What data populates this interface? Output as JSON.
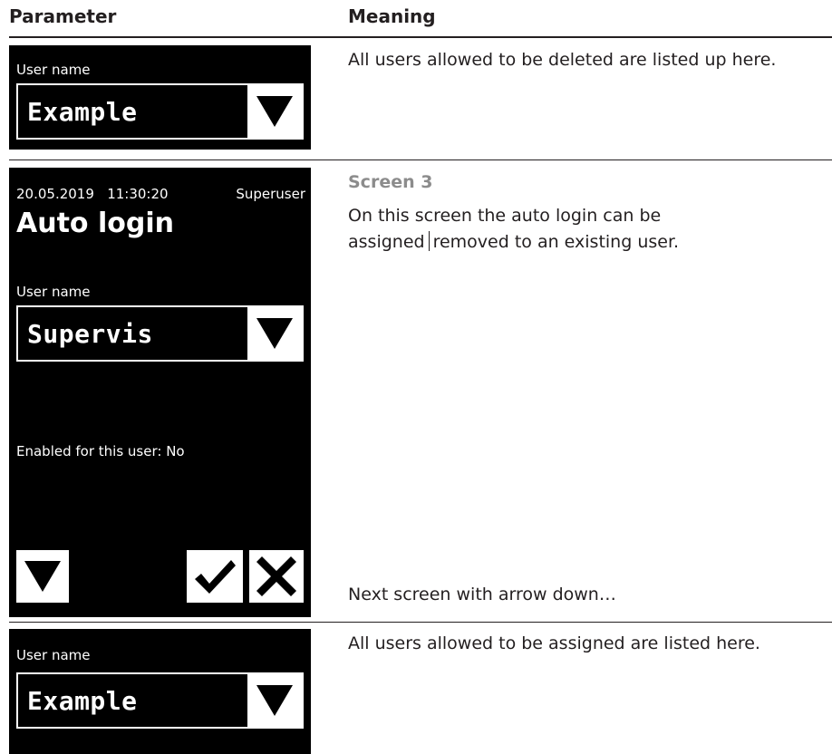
{
  "table": {
    "header_parameter": "Parameter",
    "header_meaning": "Meaning"
  },
  "row1": {
    "field_label": "User name",
    "field_value": "Example",
    "meaning": "All users allowed to be deleted are listed up here."
  },
  "row2": {
    "datetime": "20.05.2019   11:30:20",
    "user": "Superuser",
    "screen_title": "Auto login",
    "field_label": "User name",
    "field_value": "Supervis",
    "status_text": "Enabled for this user: No",
    "section_title": "Screen 3",
    "desc_part1": "On this screen the auto login can be",
    "desc_part2a": "assigned",
    "desc_part2b": "removed to an existing user.",
    "next_note": "Next screen with arrow down…"
  },
  "row3": {
    "field_label": "User name",
    "field_value": "Example",
    "meaning": "All users allowed to be assigned are listed here."
  },
  "icons": [
    "arrow-down-icon",
    "check-icon",
    "close-icon"
  ]
}
